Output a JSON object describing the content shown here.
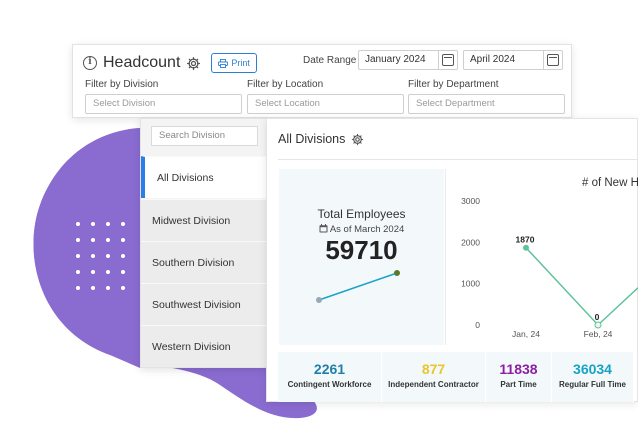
{
  "header": {
    "title": "Headcount",
    "print_label": "Print",
    "date_range_label": "Date Range",
    "start_date": "January 2024",
    "end_date": "April 2024",
    "filters": [
      {
        "label": "Filter by Division",
        "placeholder": "Select Division"
      },
      {
        "label": "Filter by Location",
        "placeholder": "Select Location"
      },
      {
        "label": "Filter by Department",
        "placeholder": "Select Department"
      }
    ]
  },
  "sidebar": {
    "search_placeholder": "Search Division",
    "items": [
      {
        "label": "All Divisions",
        "active": true
      },
      {
        "label": "Midwest Division"
      },
      {
        "label": "Southern Division"
      },
      {
        "label": "Southwest Division"
      },
      {
        "label": "Western Division"
      }
    ]
  },
  "main": {
    "title": "All Divisions",
    "total": {
      "label": "Total Employees",
      "as_of": "As of March 2024",
      "value": "59710"
    },
    "stats": [
      {
        "value": "2261",
        "label": "Contingent Workforce",
        "color": "#1f7fa8"
      },
      {
        "value": "877",
        "label": "Independent Contractor",
        "color": "#e8c72e"
      },
      {
        "value": "11838",
        "label": "Part Time",
        "color": "#8d1fa3"
      },
      {
        "value": "36034",
        "label": "Regular Full Time",
        "color": "#17a3c6"
      }
    ]
  },
  "colors": {
    "accent": "#2b7de9",
    "blob": "#8a6cd1",
    "line": "#5fc39a",
    "spark": "#1aa3c8"
  },
  "chart_data": {
    "type": "line",
    "title": "# of New H",
    "categories": [
      "Jan, 24",
      "Feb, 24"
    ],
    "series": [
      {
        "values": [
          1870,
          0
        ]
      }
    ],
    "yticks": [
      0,
      1000,
      2000,
      3000
    ],
    "ylim": [
      0,
      3000
    ],
    "data_labels": [
      "1870",
      "0"
    ]
  }
}
